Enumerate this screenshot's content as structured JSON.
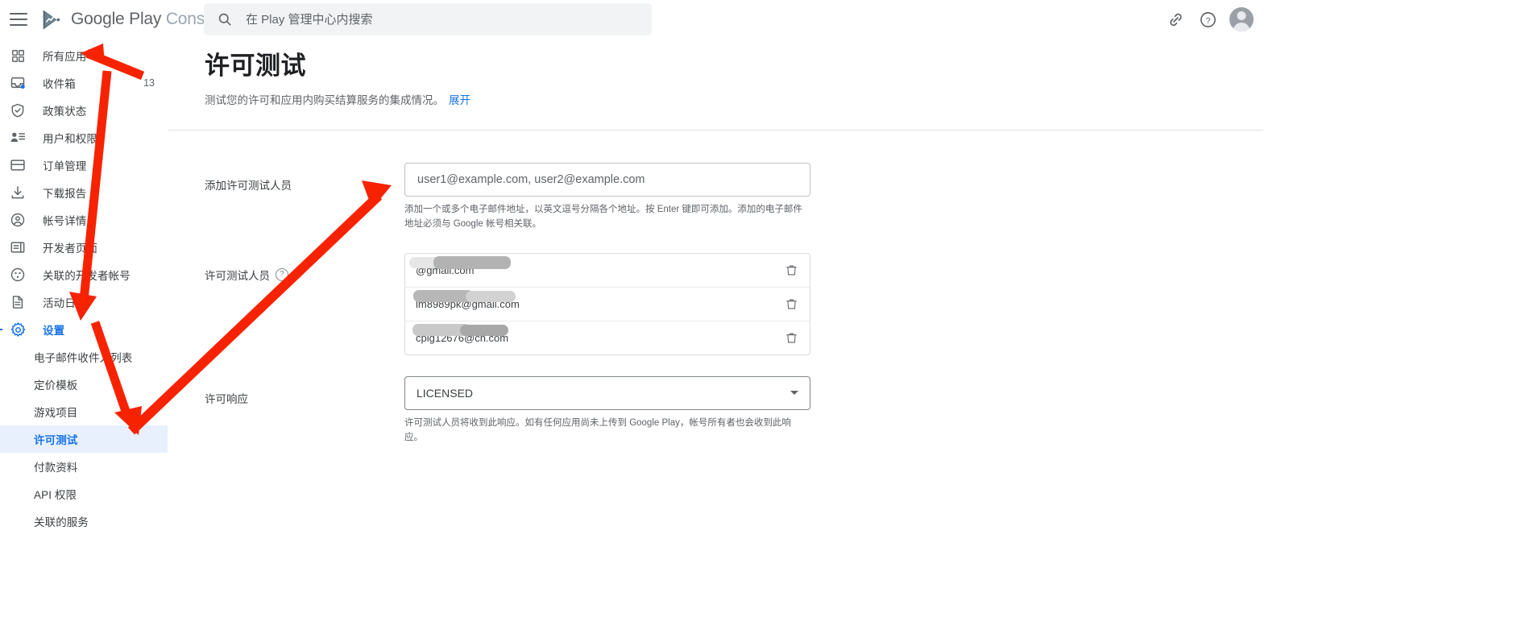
{
  "app": {
    "brand_primary": "Google Play",
    "brand_secondary": "Console",
    "menu_icon": "hamburger-icon",
    "logo_icon": "google-play-console-logo"
  },
  "search": {
    "placeholder": "在 Play 管理中心内搜索",
    "value": "",
    "icon": "search-icon"
  },
  "top_actions": [
    {
      "name": "link-icon",
      "label": "链接"
    },
    {
      "name": "help-icon",
      "label": "帮助"
    },
    {
      "name": "account-avatar",
      "label": "帐号"
    }
  ],
  "sidebar": {
    "items": [
      {
        "label": "所有应用",
        "icon": "grid-apps-icon",
        "badge": "",
        "active": false
      },
      {
        "label": "收件箱",
        "icon": "inbox-icon",
        "badge": "13",
        "active": false
      },
      {
        "label": "政策状态",
        "icon": "shield-check-icon",
        "badge": "",
        "active": false
      },
      {
        "label": "用户和权限",
        "icon": "users-permissions-icon",
        "badge": "",
        "active": false
      },
      {
        "label": "订单管理",
        "icon": "credit-card-icon",
        "badge": "",
        "active": false
      },
      {
        "label": "下载报告",
        "icon": "download-icon",
        "badge": "",
        "active": false
      },
      {
        "label": "帐号详情",
        "icon": "account-circle-icon",
        "badge": "",
        "active": false
      },
      {
        "label": "开发者页面",
        "icon": "developer-page-icon",
        "badge": "",
        "active": false
      },
      {
        "label": "关联的开发者帐号",
        "icon": "linked-accounts-icon",
        "badge": "",
        "active": false
      },
      {
        "label": "活动日志",
        "icon": "activity-log-icon",
        "badge": "",
        "active": false
      },
      {
        "label": "设置",
        "icon": "gear-icon",
        "badge": "",
        "active": true
      }
    ],
    "sub_items": [
      {
        "label": "电子邮件收件人列表",
        "selected": false
      },
      {
        "label": "定价模板",
        "selected": false
      },
      {
        "label": "游戏项目",
        "selected": false
      },
      {
        "label": "许可测试",
        "selected": true
      },
      {
        "label": "付款资料",
        "selected": false
      },
      {
        "label": "API 权限",
        "selected": false
      },
      {
        "label": "关联的服务",
        "selected": false
      }
    ]
  },
  "page": {
    "title": "许可测试",
    "subtitle": "测试您的许可和应用内购买结算服务的集成情况。",
    "expand_link": "展开"
  },
  "form": {
    "add_testers": {
      "label": "添加许可测试人员",
      "placeholder": "user1@example.com, user2@example.com",
      "value": "",
      "helper": "添加一个或多个电子邮件地址，以英文逗号分隔各个地址。按 Enter 键即可添加。添加的电子邮件地址必须与 Google 帐号相关联。"
    },
    "testers": {
      "label": "许可测试人员",
      "help_icon": "question-mark-icon",
      "rows": [
        {
          "email": "@gmail.com",
          "delete_icon": "trash-icon"
        },
        {
          "email": "lm8989pk@gmail.com",
          "delete_icon": "trash-icon"
        },
        {
          "email": "cpig12676@cn.com",
          "delete_icon": "trash-icon"
        }
      ]
    },
    "license_response": {
      "label": "许可响应",
      "selected": "LICENSED",
      "caret_icon": "chevron-down-icon",
      "helper": "许可测试人员将收到此响应。如有任何应用尚未上传到 Google Play，帐号所有者也会收到此响应。"
    }
  },
  "annotations": {
    "arrow_color": "#f723 00",
    "arrows": [
      {
        "name": "arrow-to-all-apps",
        "description": "指向「所有应用」"
      },
      {
        "name": "arrow-to-license-testing",
        "description": "指向「许可测试」"
      },
      {
        "name": "arrow-to-add-testers-input",
        "description": "指向「添加许可测试人员」输入框"
      }
    ]
  }
}
